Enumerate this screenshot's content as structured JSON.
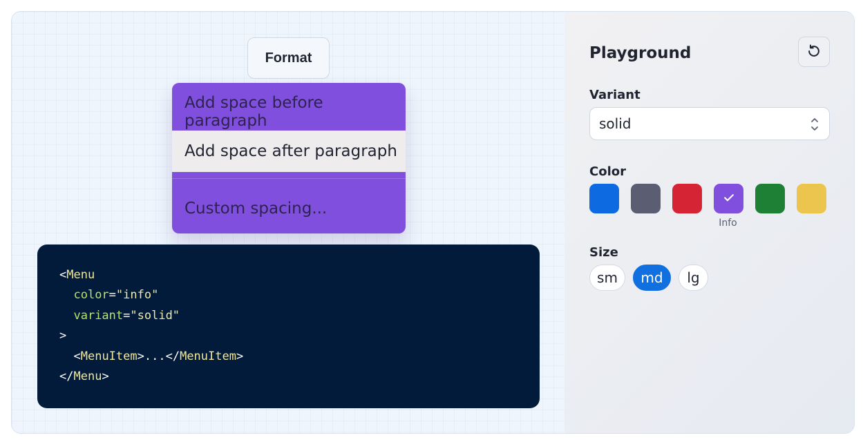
{
  "trigger": {
    "label": "Format"
  },
  "menu": {
    "items": [
      {
        "label": "Add space before paragraph"
      },
      {
        "label": "Add space after paragraph"
      },
      {
        "label": "Custom spacing..."
      }
    ],
    "highlighted_index": 1,
    "background": "#804fdd"
  },
  "code": {
    "tag": "Menu",
    "color_attr": "color",
    "color_value": "\"info\"",
    "variant_attr": "variant",
    "variant_value": "\"solid\"",
    "child_tag": "MenuItem",
    "child_content": "..."
  },
  "panel": {
    "title": "Playground",
    "reset_icon": "rotate-ccw-icon",
    "variant": {
      "label": "Variant",
      "selected": "solid"
    },
    "color": {
      "label": "Color",
      "swatches": [
        {
          "hex": "#0e6ae0"
        },
        {
          "hex": "#5b5d73"
        },
        {
          "hex": "#d52433"
        },
        {
          "hex": "#804fdd",
          "selected": true
        },
        {
          "hex": "#1d8035"
        },
        {
          "hex": "#ecc54f"
        }
      ],
      "selected_caption": "Info"
    },
    "size": {
      "label": "Size",
      "options": [
        {
          "label": "sm"
        },
        {
          "label": "md",
          "selected": true
        },
        {
          "label": "lg"
        }
      ]
    }
  }
}
